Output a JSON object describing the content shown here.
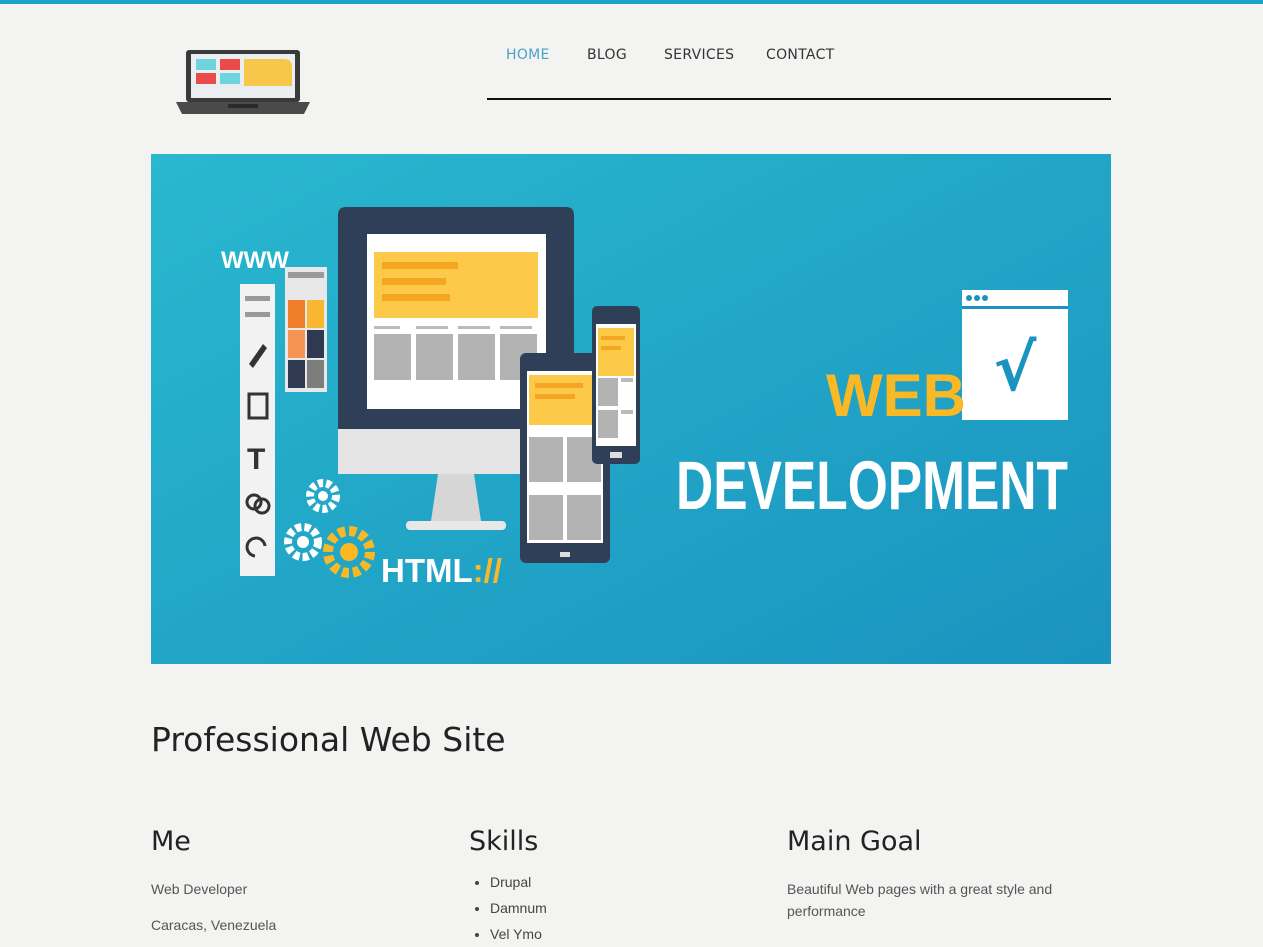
{
  "nav": {
    "items": [
      {
        "label": "HOME",
        "active": true
      },
      {
        "label": "BLOG",
        "active": false
      },
      {
        "label": "SERVICES",
        "active": false
      },
      {
        "label": "CONTACT",
        "active": false
      }
    ]
  },
  "hero": {
    "web": "WEB",
    "development": "DEVELOPMENT",
    "www": "WWW",
    "html": "HTML",
    "html_slashes": "://",
    "check": "√"
  },
  "page_heading": "Professional Web Site",
  "columns": {
    "me": {
      "title": "Me",
      "lines": [
        "Web Developer",
        "Caracas, Venezuela"
      ]
    },
    "skills": {
      "title": "Skills",
      "items": [
        "Drupal",
        "Damnum",
        "Vel Ymo"
      ]
    },
    "goal": {
      "title": "Main Goal",
      "text": "Beautiful Web pages with a great style and performance"
    }
  },
  "colors": {
    "accent": "#1aa3c4",
    "hero_bg": "#1fa9c8",
    "hero_yellow": "#f9b824"
  }
}
